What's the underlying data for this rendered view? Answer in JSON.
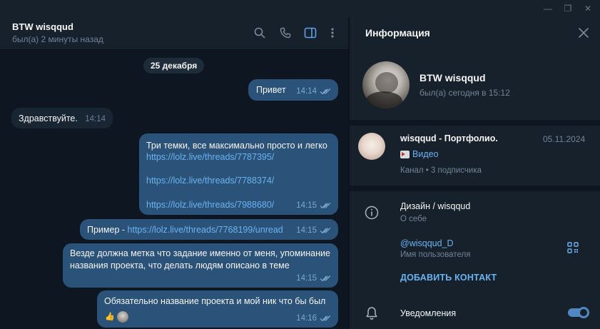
{
  "window": {
    "minimize_label": "—",
    "maximize_label": "❐",
    "close_label": "✕"
  },
  "chat": {
    "title": "BTW wisqqud",
    "status": "был(а) 2 минуты назад",
    "date_pill": "25 декабря",
    "messages": [
      {
        "direction": "out",
        "text": "Привет",
        "time": "14:14"
      },
      {
        "direction": "in",
        "text": "Здравствуйте.",
        "time": "14:14"
      },
      {
        "direction": "out",
        "text": "Три темки, все максимально просто и легко",
        "links": [
          "https://lolz.live/threads/7787395/",
          "https://lolz.live/threads/7788374/",
          "https://lolz.live/threads/7988680/"
        ],
        "time": "14:15"
      },
      {
        "direction": "out",
        "text": "Пример - ",
        "link": "https://lolz.live/threads/7768199/unread",
        "time": "14:15"
      },
      {
        "direction": "out",
        "text": "Везде должна метка что задание именно от меня, упоминание названия проекта, что делать людям описано в теме",
        "time": "14:15"
      },
      {
        "direction": "out",
        "text": "Обязательно название проекта и мой ник что бы был",
        "time": "14:16",
        "reactions": [
          "👍"
        ]
      }
    ]
  },
  "info": {
    "title": "Информация",
    "profile_name": "BTW wisqqud",
    "profile_seen": "был(а) сегодня в 15:12",
    "channel": {
      "name": "wisqqud - Портфолио.",
      "date": "05.11.2024",
      "last_post": "Видео",
      "subtitle": "Канал • 3 подписчика"
    },
    "about": {
      "value": "Дизайн / wisqqud",
      "label": "О себе"
    },
    "username": {
      "value": "@wisqqud_D",
      "label": "Имя пользователя"
    },
    "add_contact": "ДОБАВИТЬ КОНТАКТ",
    "notifications": {
      "label": "Уведомления",
      "enabled": true
    }
  },
  "colors": {
    "background": "#0e1621",
    "panel": "#17212b",
    "outgoing_bubble": "#2b5278",
    "incoming_bubble": "#182533",
    "link": "#6ab3f3",
    "accent": "#5288c1"
  }
}
